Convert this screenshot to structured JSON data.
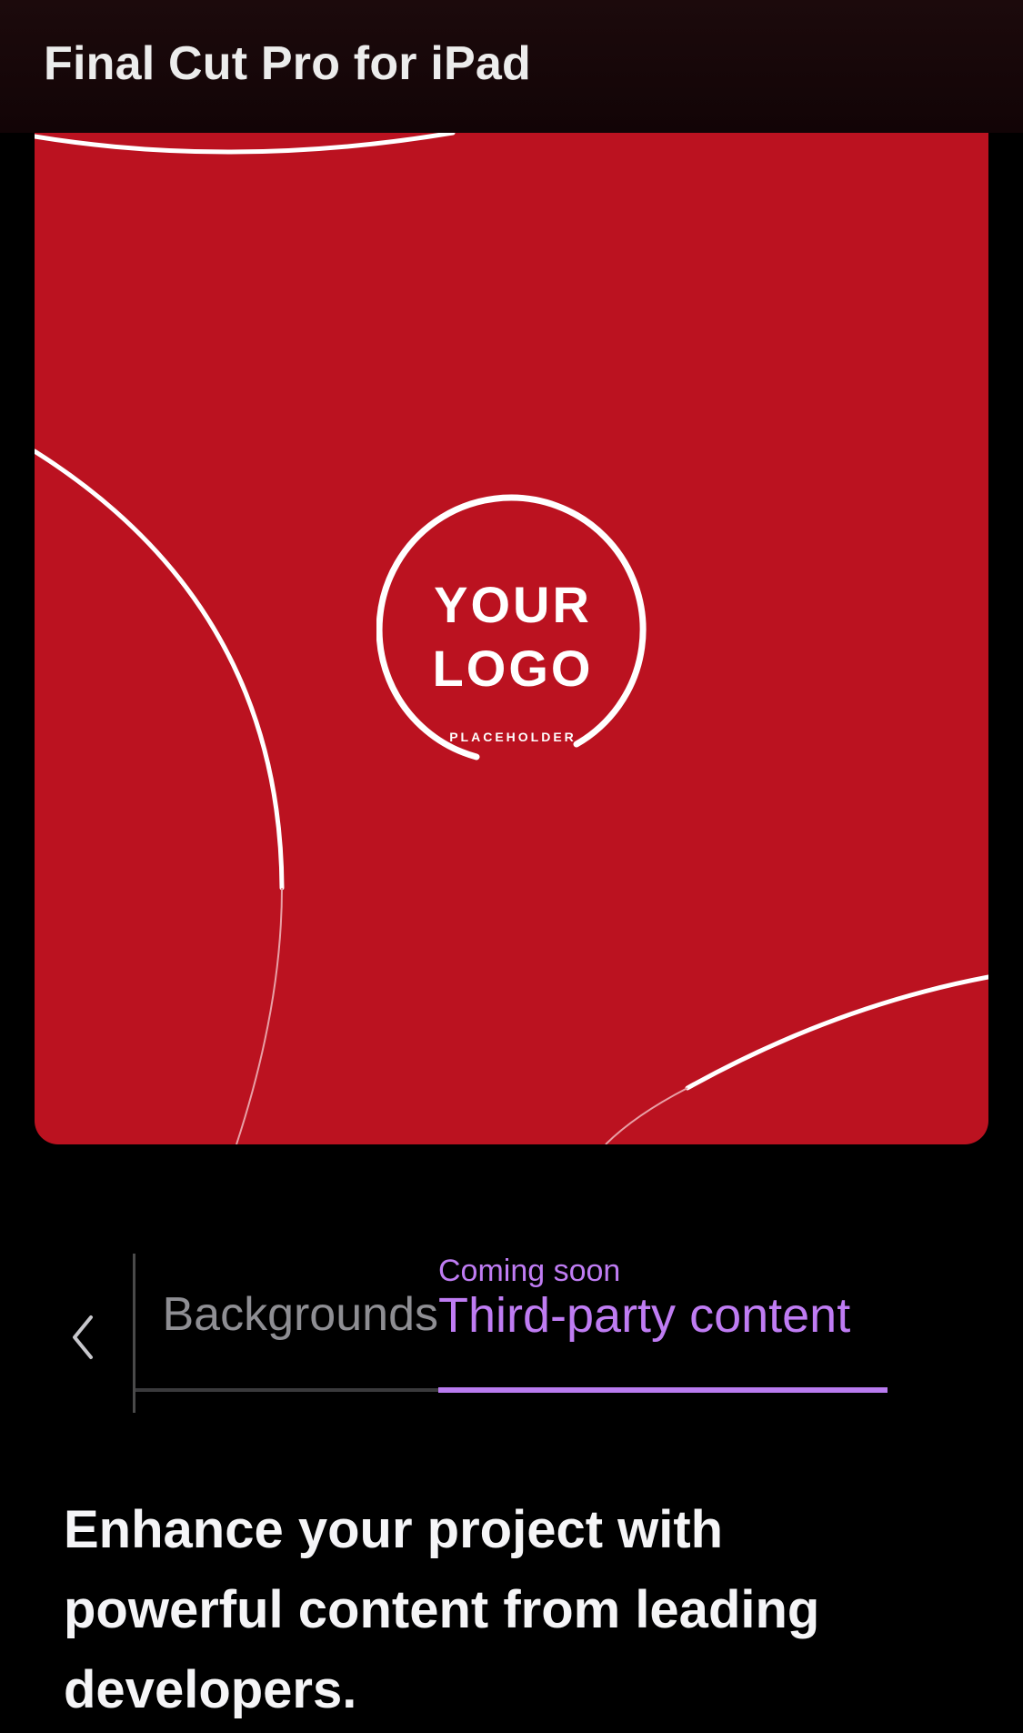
{
  "header": {
    "title": "Final Cut Pro for iPad"
  },
  "hero": {
    "background_color": "#bb1220",
    "logo": {
      "line1": "YOUR",
      "line2": "LOGO",
      "subtext": "PLACEHOLDER"
    }
  },
  "tabs": {
    "back_icon": "chevron-left-icon",
    "previous_label": "Backgrounds",
    "active": {
      "eyebrow": "Coming soon",
      "label": "Third-party content",
      "accent_color": "#bf7cf3"
    }
  },
  "description": "Enhance your project with powerful content from leading developers."
}
